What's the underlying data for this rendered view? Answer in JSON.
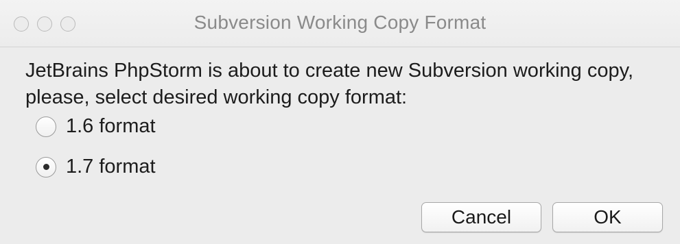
{
  "window": {
    "title": "Subversion Working Copy Format"
  },
  "message": {
    "line1": "JetBrains PhpStorm is about to create new Subversion working copy,",
    "line2": "please, select desired working copy format:"
  },
  "options": [
    {
      "label": "1.6 format",
      "selected": false
    },
    {
      "label": "1.7 format",
      "selected": true
    }
  ],
  "buttons": {
    "cancel": "Cancel",
    "ok": "OK"
  }
}
